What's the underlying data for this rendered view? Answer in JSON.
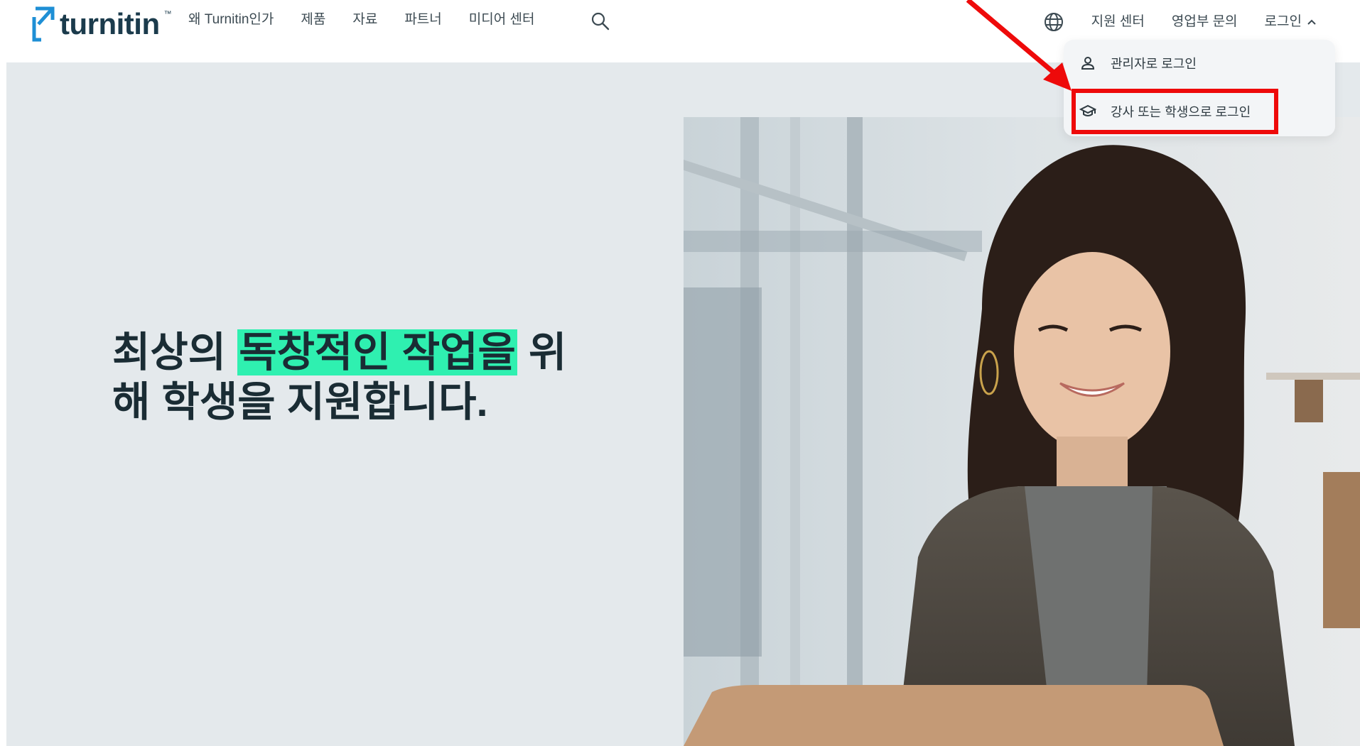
{
  "header": {
    "logo_text": "turnitin",
    "nav": [
      {
        "label": "왜 Turnitin인가"
      },
      {
        "label": "제품"
      },
      {
        "label": "자료"
      },
      {
        "label": "파트너"
      },
      {
        "label": "미디어 센터"
      }
    ],
    "search_icon": "search-icon",
    "globe_icon": "globe-icon",
    "support_label": "지원 센터",
    "sales_label": "영업부 문의",
    "login_label": "로그인",
    "login_chevron": "chevron-up-icon"
  },
  "login_menu": {
    "items": [
      {
        "label": "관리자로 로그인",
        "icon": "user-icon"
      },
      {
        "label": "강사 또는 학생으로 로그인",
        "icon": "graduation-cap-icon"
      }
    ]
  },
  "hero": {
    "headline_before": "최상의 ",
    "headline_highlight": "독창적인 작업을",
    "headline_after": " 위해 학생을 지원합니다."
  },
  "colors": {
    "brand_navy": "#1b3b4c",
    "brand_blue": "#1e8fd5",
    "highlight_green": "#2ff0b0",
    "hero_bg": "#e4e9ec",
    "annotation_red": "#ee0a0a"
  }
}
